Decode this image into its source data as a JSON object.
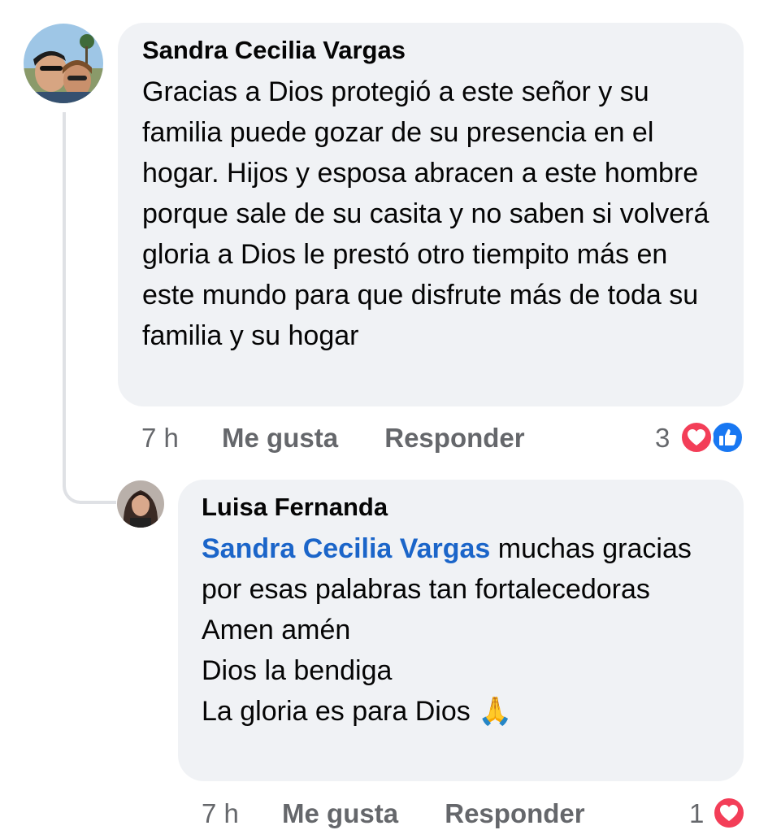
{
  "comment": {
    "author": "Sandra Cecilia Vargas",
    "text": "Gracias a Dios protegió a este señor y su familia puede gozar de su presencia en el hogar. Hijos y esposa abracen a este hombre porque sale de su casita y no saben si volverá gloria a Dios le prestó otro tiempito más en este mundo para que disfrute más de toda su familia y su hogar",
    "time": "7 h",
    "like_label": "Me gusta",
    "reply_label": "Responder",
    "reaction_count": "3",
    "reactions": [
      "love",
      "like"
    ]
  },
  "reply": {
    "author": "Luisa Fernanda",
    "mention": "Sandra Cecilia Vargas",
    "lines": [
      "muchas gracias por esas palabras tan fortalecedoras",
      "Amen amén",
      "Dios la bendiga",
      "La gloria es para Dios 🙏"
    ],
    "time": "7 h",
    "like_label": "Me gusta",
    "reply_label": "Responder",
    "reaction_count": "1",
    "reactions": [
      "love"
    ]
  },
  "colors": {
    "bubble": "#f0f2f5",
    "mention": "#1b65c9",
    "meta": "#65676b",
    "love": "#f33e58",
    "like": "#1877f2",
    "thread_line": "#dfe1e5"
  }
}
